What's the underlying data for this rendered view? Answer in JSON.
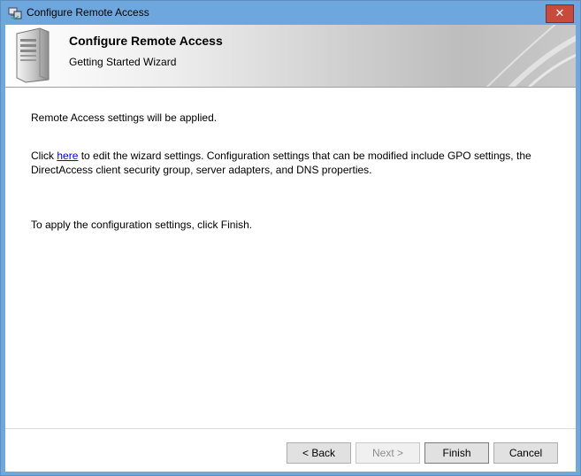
{
  "window": {
    "title": "Configure Remote Access",
    "close_label": "✕"
  },
  "banner": {
    "title": "Configure Remote Access",
    "subtitle": "Getting Started Wizard"
  },
  "content": {
    "line1": "Remote Access settings will be applied.",
    "line2_prefix": "Click ",
    "line2_link": "here",
    "line2_suffix": " to edit the wizard settings. Configuration settings that can be modified include GPO settings, the DirectAccess client security group, server adapters, and DNS properties.",
    "line3": "To apply the configuration settings, click Finish."
  },
  "buttons": {
    "back": "< Back",
    "next": "Next >",
    "finish": "Finish",
    "cancel": "Cancel"
  },
  "colors": {
    "titlebar": "#6ea7dd",
    "close": "#c74a3a",
    "link": "#0000ee"
  }
}
